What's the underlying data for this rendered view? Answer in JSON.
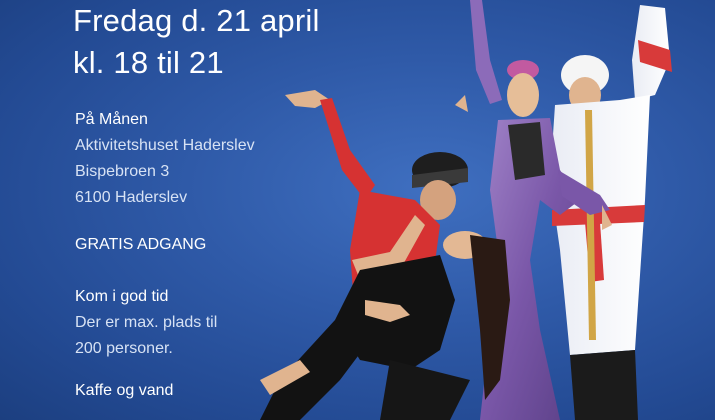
{
  "event": {
    "date_line": "Fredag d. 21 april",
    "time_line": "kl. 18 til 21"
  },
  "venue": {
    "label": "På Månen",
    "building": "Aktivitetshuset Haderslev",
    "street": "Bispebroen 3",
    "city": "6100 Haderslev"
  },
  "admission": {
    "label": "GRATIS ADGANG"
  },
  "notice": {
    "heading": "Kom i god tid",
    "line1": "Der er max. plads til",
    "line2": "200 personer."
  },
  "refreshments": {
    "label": "Kaffe og vand"
  },
  "colors": {
    "background": "#2f5aa8",
    "text": "#ffffff",
    "muted_text": "#d7e2f4"
  }
}
